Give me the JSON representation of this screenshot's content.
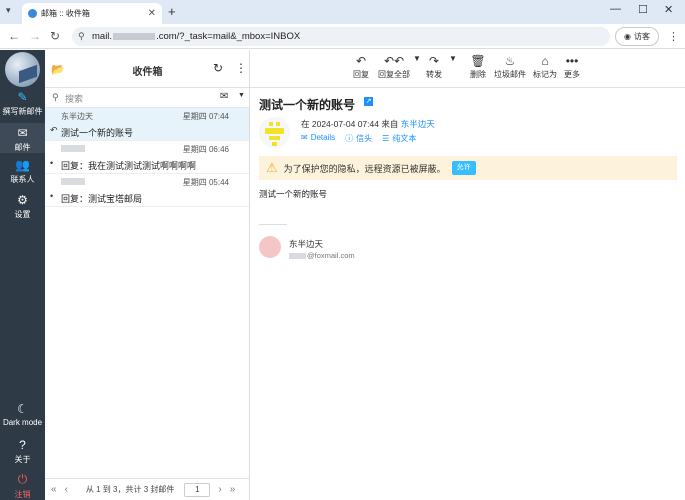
{
  "browser": {
    "tab_title": "邮箱 :: 收件箱",
    "new_tab": "+",
    "url_prefix": "mail.",
    "url_suffix": ".com/?_task=mail&_mbox=INBOX",
    "guest_label": "访客"
  },
  "sidebar": {
    "compose": "撰写新邮件",
    "mail": "邮件",
    "contacts": "联系人",
    "settings": "设置",
    "dark_mode": "Dark mode",
    "about": "关于",
    "logout": "注销"
  },
  "list": {
    "folder_title": "收件箱",
    "search_placeholder": "搜索",
    "messages": [
      {
        "from": "东半边天",
        "date": "星期四 07:44",
        "subject": "测试一个新的账号",
        "selected": true,
        "flag": "replied"
      },
      {
        "from": "",
        "date": "星期四 06:46",
        "subject": "回复：我在测试测试测试啊啊啊啊",
        "selected": false,
        "flag": "unread"
      },
      {
        "from": "",
        "date": "星期四 05:44",
        "subject": "回复：测试宝塔邮局",
        "selected": false,
        "flag": "unread"
      }
    ],
    "footer_count": "从 1 到 3，共计 3 封邮件",
    "page": "1"
  },
  "toolbar": {
    "reply": "回复",
    "reply_all": "回复全部",
    "forward": "转发",
    "delete": "删除",
    "junk": "垃圾邮件",
    "mark": "标记为",
    "more": "更多"
  },
  "message": {
    "subject": "测试一个新的账号",
    "meta_prefix": "在 2024-07-04 07:44 来自",
    "sender": "东半边天",
    "link_details": "Details",
    "link_headers": "信头",
    "link_plain": "纯文本",
    "warning": "为了保护您的隐私，远程资源已被屏蔽。",
    "allow": "允许",
    "body": "测试一个新的账号",
    "sig_name": "东半边天",
    "sig_mail": "@foxmail.com"
  }
}
